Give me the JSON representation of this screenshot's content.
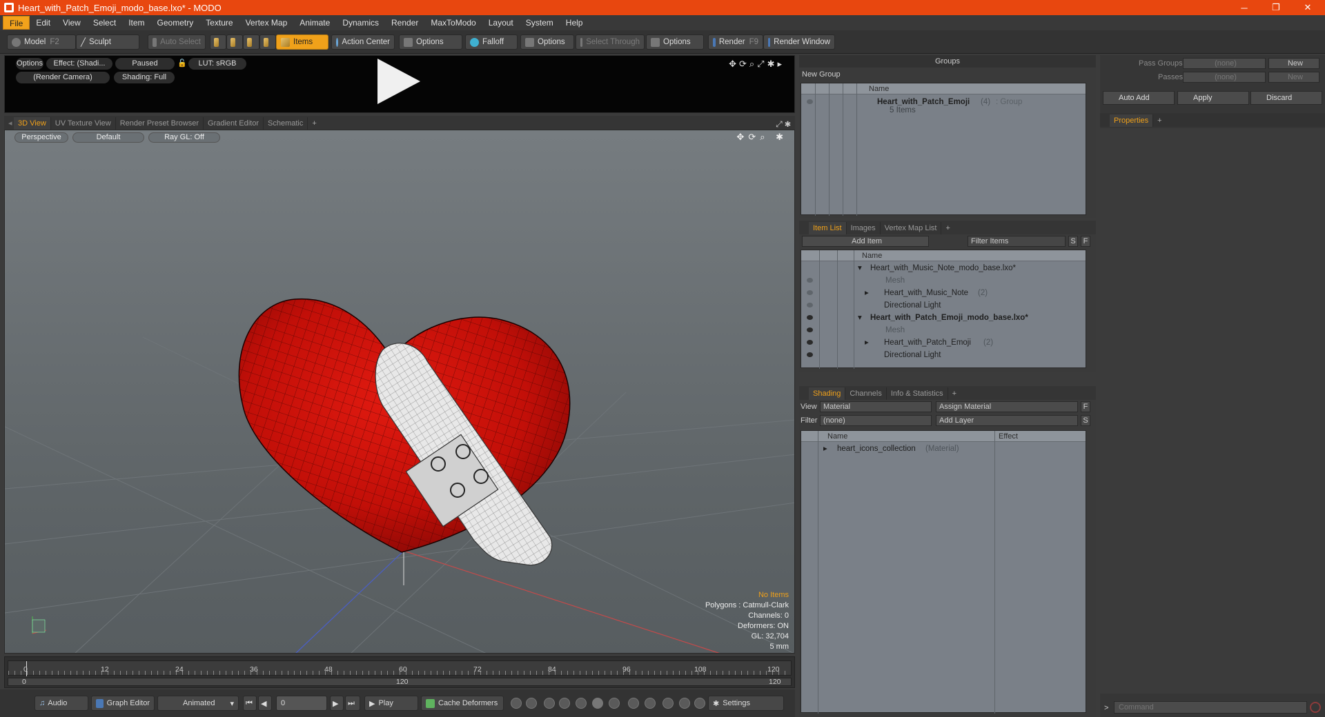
{
  "window": {
    "title": "Heart_with_Patch_Emoji_modo_base.lxo* - MODO",
    "minimize": "─",
    "maximize": "❐",
    "close": "✕"
  },
  "menu": [
    "File",
    "Edit",
    "View",
    "Select",
    "Item",
    "Geometry",
    "Texture",
    "Vertex Map",
    "Animate",
    "Dynamics",
    "Render",
    "MaxToModo",
    "Layout",
    "System",
    "Help"
  ],
  "toolbar": {
    "model": "Model",
    "model_key": "F2",
    "sculpt": "Sculpt",
    "auto_select": "Auto Select",
    "items": "Items",
    "action_center": "Action Center",
    "options1": "Options",
    "falloff": "Falloff",
    "options2": "Options",
    "select_through": "Select Through",
    "options3": "Options",
    "render": "Render",
    "render_key": "F9",
    "render_window": "Render Window"
  },
  "preview": {
    "options": "Options",
    "effect": "Effect: (Shadi...",
    "paused": "Paused",
    "lut": "LUT: sRGB",
    "camera": "(Render Camera)",
    "shading": "Shading: Full"
  },
  "viewport_tabs": [
    "3D View",
    "UV Texture View",
    "Render Preset Browser",
    "Gradient Editor",
    "Schematic",
    "+"
  ],
  "viewport": {
    "perspective": "Perspective",
    "default": "Default",
    "raygl": "Ray GL: Off",
    "info": {
      "no_items": "No Items",
      "polygons": "Polygons : Catmull-Clark",
      "channels": "Channels: 0",
      "deformers": "Deformers: ON",
      "gl": "GL: 32,704",
      "unit": "5 mm"
    }
  },
  "timeline": {
    "ticks": [
      "0",
      "12",
      "24",
      "36",
      "48",
      "60",
      "72",
      "84",
      "96",
      "108",
      "120"
    ],
    "left_end": "0",
    "mid": "120",
    "right_end": "120"
  },
  "bottombar": {
    "audio": "Audio",
    "graph_editor": "Graph Editor",
    "animated": "Animated",
    "frame": "0",
    "play": "Play",
    "cache_deformers": "Cache Deformers",
    "settings": "Settings"
  },
  "groups": {
    "title": "Groups",
    "new_group": "New Group",
    "col_name": "Name",
    "row_name": "Heart_with_Patch_Emoji",
    "row_count": "(4)",
    "row_type": ": Group",
    "row_sub": "5 Items"
  },
  "passes": {
    "pass_groups": "Pass Groups",
    "passes": "Passes",
    "none1": "(none)",
    "none2": "(none)",
    "new1": "New",
    "new2": "New",
    "auto_add": "Auto Add",
    "apply": "Apply",
    "discard": "Discard",
    "properties_tab": "Properties",
    "plus": "+"
  },
  "itemlist": {
    "tabs": [
      "Item List",
      "Images",
      "Vertex Map List",
      "+"
    ],
    "add_item": "Add Item",
    "filter": "Filter Items",
    "s": "S",
    "f": "F",
    "col_name": "Name",
    "rows": [
      {
        "label": "Heart_with_Music_Note_modo_base.lxo*",
        "bold": false
      },
      {
        "label": "Mesh",
        "bold": false
      },
      {
        "label": "Heart_with_Music_Note",
        "count": "(2)"
      },
      {
        "label": "Directional Light"
      },
      {
        "label": "Heart_with_Patch_Emoji_modo_base.lxo*",
        "bold": true
      },
      {
        "label": "Mesh"
      },
      {
        "label": "Heart_with_Patch_Emoji",
        "count": "(2)"
      },
      {
        "label": "Directional Light"
      }
    ]
  },
  "shading": {
    "tabs": [
      "Shading",
      "Channels",
      "Info & Statistics",
      "+"
    ],
    "view_lbl": "View",
    "view_val": "Material",
    "assign": "Assign Material",
    "f": "F",
    "filter_lbl": "Filter",
    "filter_val": "(none)",
    "add_layer": "Add Layer",
    "s": "S",
    "col_name": "Name",
    "col_effect": "Effect",
    "row_name": "heart_icons_collection",
    "row_type": "(Material)"
  },
  "command": {
    "prompt": ">",
    "placeholder": "Command"
  }
}
